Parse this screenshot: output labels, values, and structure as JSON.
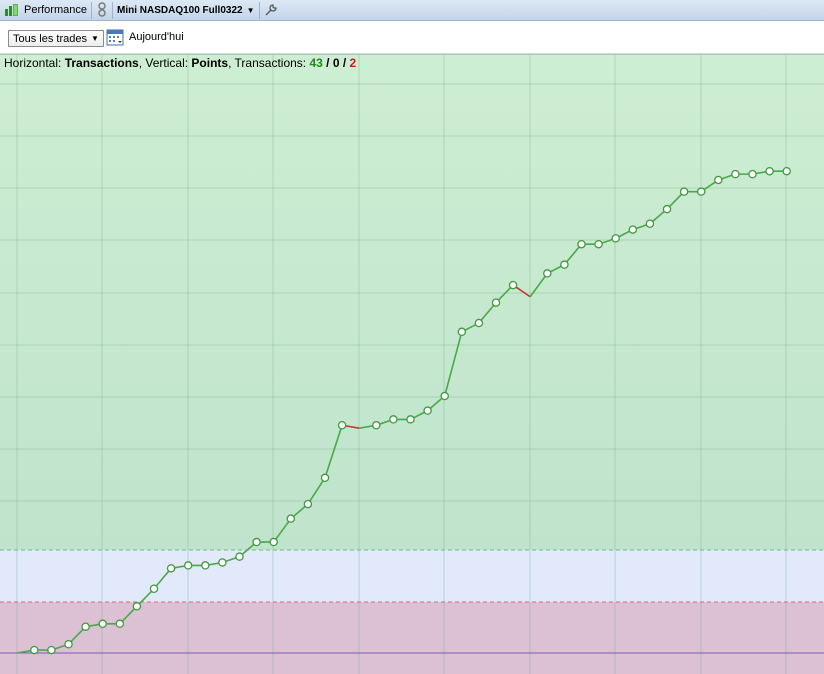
{
  "titlebar": {
    "app_label": "Performance",
    "instrument_label": "Mini NASDAQ100 Full0322"
  },
  "toolbar": {
    "filter_selected": "Tous les trades",
    "date_label": "Aujourd'hui"
  },
  "legend": {
    "h_prefix": "Horizontal: ",
    "h_value": "Transactions",
    "v_prefix": ", Vertical: ",
    "v_value": "Points",
    "t_prefix": ", Transactions: ",
    "t_win": "43",
    "t_sep1": " / ",
    "t_even": "0",
    "t_sep2": " / ",
    "t_loss": "2"
  },
  "colors": {
    "profit_zone": "#c9ebd0",
    "neutral_zone": "#e0e8fa",
    "loss_zone": "#dcc0d3",
    "up_segment": "#4aa84a",
    "down_segment": "#cc3333",
    "baseline": "#7b5ab8"
  },
  "chart_data": {
    "type": "line",
    "xlabel": "Transactions",
    "ylabel": "Points",
    "grid": true,
    "x": [
      0,
      1,
      2,
      3,
      4,
      5,
      6,
      7,
      8,
      9,
      10,
      11,
      12,
      13,
      14,
      15,
      16,
      17,
      18,
      19,
      20,
      21,
      22,
      23,
      24,
      25,
      26,
      27,
      28,
      29,
      30,
      31,
      32,
      33,
      34,
      35,
      36,
      37,
      38,
      39,
      40,
      41,
      42,
      43,
      44,
      45
    ],
    "values": [
      0,
      0.1,
      0.1,
      0.3,
      0.9,
      1.0,
      1.0,
      1.6,
      2.2,
      2.9,
      3.0,
      3.0,
      3.1,
      3.3,
      3.8,
      3.8,
      4.6,
      5.1,
      6.0,
      7.8,
      7.7,
      7.8,
      8.0,
      8.0,
      8.3,
      8.8,
      11.0,
      11.3,
      12.0,
      12.6,
      12.2,
      13.0,
      13.3,
      14.0,
      14.0,
      14.2,
      14.5,
      14.7,
      15.2,
      15.8,
      15.8,
      16.2,
      16.4,
      16.4,
      16.5,
      16.5
    ],
    "zones": [
      "profit",
      "neutral",
      "loss"
    ]
  }
}
